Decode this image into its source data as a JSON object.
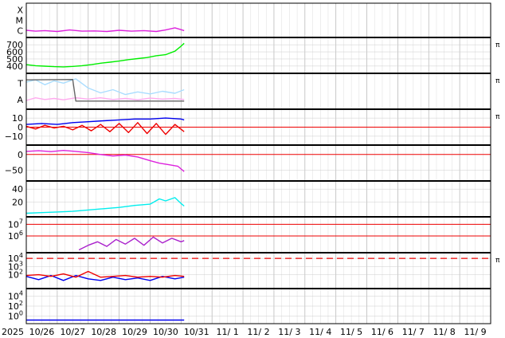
{
  "chart_data": {
    "type": "line",
    "time_axis": {
      "year_label": "2025",
      "ticks": [
        "10/26",
        "10/27",
        "10/28",
        "10/29",
        "10/30",
        "10/31",
        "11/ 1",
        "11/ 2",
        "11/ 3",
        "11/ 4",
        "11/ 5",
        "11/ 6",
        "11/ 7",
        "11/ 8",
        "11/ 9"
      ],
      "range_days": [
        0,
        15
      ],
      "data_end_day": 5.1
    },
    "grid": true,
    "right_marker": "π",
    "colors": {
      "magenta": "#dd22dd",
      "green": "#00ee00",
      "light_blue": "#aaddff",
      "pink": "#ffaaee",
      "blue": "#0000ee",
      "red": "#ee0000",
      "cyan": "#00eeee",
      "purple": "#aa22cc",
      "gray": "#666666",
      "grid": "#cccccc",
      "panel_border": "#000000"
    },
    "panels": [
      {
        "id": "xmc",
        "tick_labels": [
          "X",
          "M",
          "C"
        ],
        "ylim": [
          0,
          10
        ],
        "right_marker": false,
        "series": [
          {
            "color": "magenta",
            "values": [
              [
                0,
                1.8
              ],
              [
                0.3,
                1.5
              ],
              [
                0.6,
                1.7
              ],
              [
                1.0,
                1.4
              ],
              [
                1.4,
                1.9
              ],
              [
                1.8,
                1.5
              ],
              [
                2.2,
                1.6
              ],
              [
                2.6,
                1.4
              ],
              [
                3.0,
                1.8
              ],
              [
                3.4,
                1.5
              ],
              [
                3.8,
                1.7
              ],
              [
                4.2,
                1.4
              ],
              [
                4.5,
                1.9
              ],
              [
                4.8,
                2.6
              ],
              [
                5.0,
                2.0
              ],
              [
                5.1,
                1.7
              ]
            ]
          }
        ]
      },
      {
        "id": "solar-wind-speed",
        "tick_labels": [
          "700",
          "600",
          "500",
          "400"
        ],
        "tick_values": [
          700,
          600,
          500,
          400
        ],
        "ylim": [
          320,
          780
        ],
        "right_marker": true,
        "series": [
          {
            "color": "green",
            "values": [
              [
                0,
                420
              ],
              [
                0.3,
                405
              ],
              [
                0.6,
                398
              ],
              [
                0.9,
                392
              ],
              [
                1.2,
                388
              ],
              [
                1.5,
                395
              ],
              [
                1.8,
                405
              ],
              [
                2.1,
                420
              ],
              [
                2.4,
                440
              ],
              [
                2.7,
                455
              ],
              [
                3.0,
                470
              ],
              [
                3.3,
                490
              ],
              [
                3.6,
                505
              ],
              [
                3.9,
                520
              ],
              [
                4.2,
                545
              ],
              [
                4.5,
                560
              ],
              [
                4.8,
                610
              ],
              [
                5.0,
                680
              ],
              [
                5.1,
                720
              ]
            ]
          }
        ]
      },
      {
        "id": "imf-sector",
        "tick_labels": [
          "T",
          "A"
        ],
        "ylim": [
          0,
          10
        ],
        "right_marker": true,
        "series": [
          {
            "color": "light_blue",
            "values": [
              [
                0,
                7.8
              ],
              [
                0.3,
                8.5
              ],
              [
                0.6,
                7.0
              ],
              [
                0.9,
                8.2
              ],
              [
                1.2,
                7.5
              ],
              [
                1.6,
                8.8
              ],
              [
                2.0,
                6.0
              ],
              [
                2.4,
                4.5
              ],
              [
                2.8,
                5.5
              ],
              [
                3.2,
                4.0
              ],
              [
                3.6,
                4.8
              ],
              [
                4.0,
                4.2
              ],
              [
                4.4,
                5.0
              ],
              [
                4.8,
                4.4
              ],
              [
                5.1,
                5.5
              ]
            ]
          },
          {
            "color": "pink",
            "values": [
              [
                0,
                2.2
              ],
              [
                0.3,
                3.0
              ],
              [
                0.6,
                2.5
              ],
              [
                0.9,
                2.8
              ],
              [
                1.2,
                2.4
              ],
              [
                1.6,
                3.0
              ],
              [
                2.0,
                2.6
              ],
              [
                2.4,
                3.0
              ],
              [
                2.8,
                2.5
              ],
              [
                3.2,
                2.8
              ],
              [
                3.6,
                2.4
              ],
              [
                4.0,
                2.9
              ],
              [
                4.4,
                2.6
              ],
              [
                4.8,
                2.8
              ],
              [
                5.1,
                2.5
              ]
            ]
          },
          {
            "color": "gray",
            "values": [
              [
                0,
                8.5
              ],
              [
                1.5,
                8.6
              ],
              [
                1.6,
                2.0
              ],
              [
                5.1,
                2.0
              ]
            ]
          }
        ]
      },
      {
        "id": "imf-components",
        "tick_labels": [
          "10",
          "0",
          "−10"
        ],
        "tick_values": [
          10,
          0,
          -10
        ],
        "ylim": [
          -18,
          18
        ],
        "right_marker": true,
        "zero_line": 0,
        "series": [
          {
            "color": "blue",
            "values": [
              [
                0,
                3
              ],
              [
                0.5,
                4
              ],
              [
                1.0,
                3
              ],
              [
                1.5,
                5
              ],
              [
                2.0,
                6
              ],
              [
                2.5,
                7
              ],
              [
                3.0,
                8
              ],
              [
                3.5,
                9
              ],
              [
                4.0,
                9
              ],
              [
                4.5,
                10
              ],
              [
                5.0,
                9
              ],
              [
                5.1,
                8
              ]
            ]
          },
          {
            "color": "red",
            "values": [
              [
                0,
                1
              ],
              [
                0.3,
                -2
              ],
              [
                0.6,
                2
              ],
              [
                0.9,
                -1
              ],
              [
                1.2,
                1
              ],
              [
                1.5,
                -3
              ],
              [
                1.8,
                2
              ],
              [
                2.1,
                -4
              ],
              [
                2.4,
                3
              ],
              [
                2.7,
                -5
              ],
              [
                3.0,
                4
              ],
              [
                3.3,
                -6
              ],
              [
                3.6,
                5
              ],
              [
                3.9,
                -7
              ],
              [
                4.2,
                4
              ],
              [
                4.5,
                -8
              ],
              [
                4.8,
                3
              ],
              [
                5.1,
                -5
              ]
            ]
          }
        ]
      },
      {
        "id": "dst",
        "tick_labels": [
          "0",
          "−50"
        ],
        "tick_values": [
          0,
          -50
        ],
        "ylim": [
          -80,
          25
        ],
        "right_marker": false,
        "zero_line": 0,
        "series": [
          {
            "color": "magenta",
            "values": [
              [
                0,
                10
              ],
              [
                0.4,
                12
              ],
              [
                0.8,
                9
              ],
              [
                1.2,
                13
              ],
              [
                1.6,
                10
              ],
              [
                2.0,
                6
              ],
              [
                2.4,
                0
              ],
              [
                2.8,
                -5
              ],
              [
                3.2,
                -2
              ],
              [
                3.6,
                -8
              ],
              [
                4.0,
                -20
              ],
              [
                4.3,
                -28
              ],
              [
                4.6,
                -33
              ],
              [
                4.9,
                -38
              ],
              [
                5.1,
                -55
              ]
            ]
          }
        ]
      },
      {
        "id": "ae-index",
        "tick_labels": [
          "40",
          "20"
        ],
        "tick_values": [
          40,
          20
        ],
        "ylim": [
          0,
          50
        ],
        "right_marker": false,
        "series": [
          {
            "color": "cyan",
            "values": [
              [
                0,
                3
              ],
              [
                0.5,
                4
              ],
              [
                1.0,
                5
              ],
              [
                1.5,
                6
              ],
              [
                2.0,
                8
              ],
              [
                2.5,
                10
              ],
              [
                3.0,
                12
              ],
              [
                3.5,
                15
              ],
              [
                4.0,
                17
              ],
              [
                4.3,
                25
              ],
              [
                4.5,
                22
              ],
              [
                4.8,
                27
              ],
              [
                5.0,
                18
              ],
              [
                5.1,
                14
              ]
            ]
          }
        ]
      },
      {
        "id": "electron-flux",
        "tick_labels": [
          "10^7",
          "10^6"
        ],
        "tick_values": [
          7,
          6
        ],
        "ylim": [
          4.7,
          7.5
        ],
        "right_marker": false,
        "ref_lines": [
          7,
          6
        ],
        "series": [
          {
            "color": "purple",
            "values": [
              [
                1.7,
                4.8
              ],
              [
                2.0,
                5.2
              ],
              [
                2.3,
                5.5
              ],
              [
                2.6,
                5.1
              ],
              [
                2.9,
                5.7
              ],
              [
                3.2,
                5.3
              ],
              [
                3.5,
                5.8
              ],
              [
                3.8,
                5.2
              ],
              [
                4.1,
                5.9
              ],
              [
                4.4,
                5.4
              ],
              [
                4.7,
                5.8
              ],
              [
                5.0,
                5.5
              ],
              [
                5.1,
                5.6
              ]
            ]
          }
        ]
      },
      {
        "id": "proton-flux",
        "tick_labels": [
          "10^4",
          "10^3",
          "10^2"
        ],
        "tick_values": [
          4,
          3,
          2
        ],
        "ylim": [
          0.5,
          4.5
        ],
        "right_marker": true,
        "dashed_line": 4,
        "series": [
          {
            "color": "blue",
            "values": [
              [
                0,
                1.8
              ],
              [
                0.4,
                1.4
              ],
              [
                0.8,
                1.9
              ],
              [
                1.2,
                1.3
              ],
              [
                1.6,
                1.9
              ],
              [
                2.0,
                1.5
              ],
              [
                2.4,
                1.3
              ],
              [
                2.8,
                1.7
              ],
              [
                3.2,
                1.4
              ],
              [
                3.6,
                1.6
              ],
              [
                4.0,
                1.3
              ],
              [
                4.4,
                1.8
              ],
              [
                4.8,
                1.5
              ],
              [
                5.1,
                1.7
              ]
            ]
          },
          {
            "color": "red",
            "values": [
              [
                0,
                1.9
              ],
              [
                0.4,
                2.0
              ],
              [
                0.8,
                1.8
              ],
              [
                1.2,
                2.1
              ],
              [
                1.6,
                1.7
              ],
              [
                2.0,
                2.4
              ],
              [
                2.4,
                1.7
              ],
              [
                2.8,
                1.8
              ],
              [
                3.2,
                1.9
              ],
              [
                3.6,
                1.7
              ],
              [
                4.0,
                1.8
              ],
              [
                4.4,
                1.7
              ],
              [
                4.8,
                1.9
              ],
              [
                5.1,
                1.8
              ]
            ]
          }
        ]
      },
      {
        "id": "neutron-flux",
        "tick_labels": [
          "10^4",
          "10^2",
          "10^0"
        ],
        "tick_values": [
          4,
          2,
          0
        ],
        "ylim": [
          -1.2,
          5.2
        ],
        "right_marker": false,
        "series": [
          {
            "color": "blue",
            "values": [
              [
                0,
                -0.8
              ],
              [
                1,
                -0.8
              ],
              [
                2,
                -0.8
              ],
              [
                3,
                -0.8
              ],
              [
                4,
                -0.8
              ],
              [
                5,
                -0.8
              ],
              [
                5.1,
                -0.8
              ]
            ]
          }
        ]
      }
    ]
  }
}
